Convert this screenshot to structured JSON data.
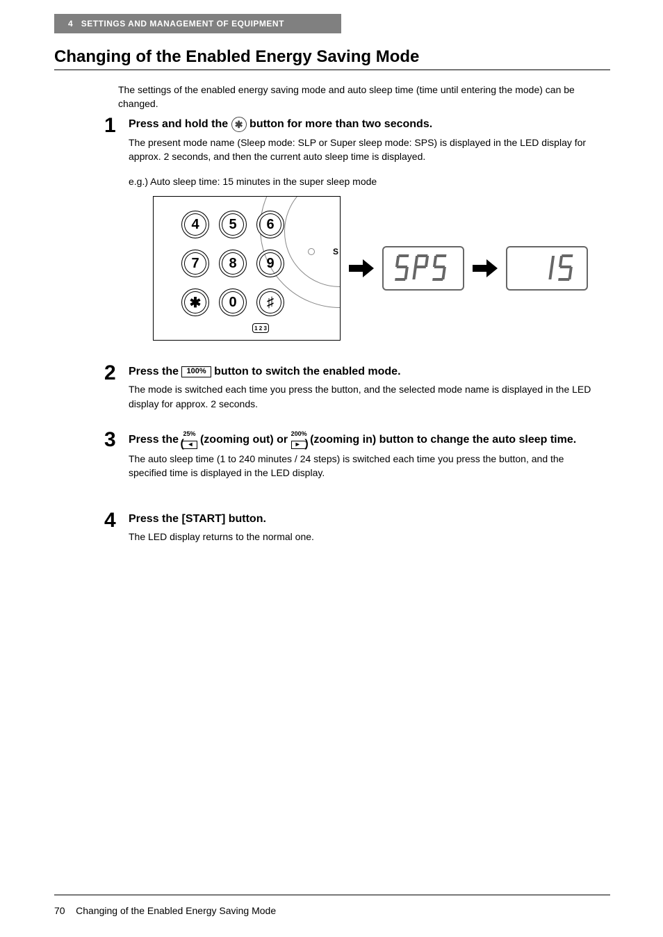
{
  "header": {
    "chapter": "4",
    "chapter_title": "SETTINGS AND MANAGEMENT OF EQUIPMENT"
  },
  "title": "Changing of the Enabled Energy Saving Mode",
  "intro": "The settings of the enabled energy saving mode and auto sleep time (time until entering the mode) can be changed.",
  "steps": [
    {
      "num": "1",
      "head_pre": "Press and hold the ",
      "head_icon": "star-circle-icon",
      "head_post": " button for more than two seconds.",
      "body": "The present mode name (Sleep mode: SLP or Super sleep mode: SPS) is displayed in the LED display for approx. 2 seconds, and then the current auto sleep time is displayed.",
      "example": "e.g.) Auto sleep time: 15 minutes in the super sleep mode"
    },
    {
      "num": "2",
      "head_pre": "Press the ",
      "head_icon_label": "100%",
      "head_post": " button to switch the enabled mode.",
      "body": "The mode is switched each time you press the button, and the selected mode name is displayed in the LED display for approx. 2 seconds."
    },
    {
      "num": "3",
      "head_parts": {
        "a": "Press the ",
        "zoom_out_top": "25%",
        "b": "(zooming out) or ",
        "zoom_in_top": "200%",
        "c": "(zooming in) button to change the auto sleep time."
      },
      "body": "The auto sleep time (1 to 240 minutes / 24 steps) is switched each time you press the button, and the specified time is displayed in the LED display."
    },
    {
      "num": "4",
      "head": "Press the [START] button.",
      "body": "The LED display returns to the normal one."
    }
  ],
  "diagram": {
    "keypad_rows": [
      [
        "4",
        "5",
        "6"
      ],
      [
        "7",
        "8",
        "9"
      ],
      [
        "✱",
        "0",
        "♯"
      ]
    ],
    "small_label": "1 2 3",
    "partial_text": "S",
    "lcd1": "SPS",
    "lcd2": "15"
  },
  "footer": {
    "page": "70",
    "title": "Changing of the Enabled Energy Saving Mode"
  }
}
